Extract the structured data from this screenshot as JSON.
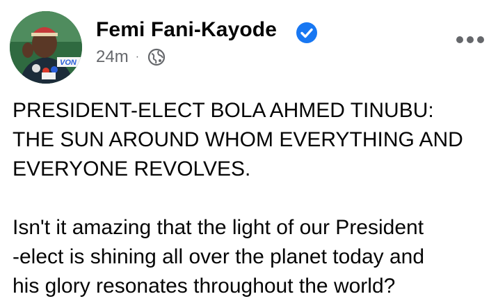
{
  "post": {
    "author": {
      "name": "Femi Fani-Kayode",
      "verified": true,
      "avatar_banner_text": "VON"
    },
    "timestamp": "24m",
    "separator": "·",
    "privacy_icon": "globe-icon",
    "more_icon": "more-horizontal-icon",
    "paragraphs": [
      "PRESIDENT-ELECT BOLA AHMED TINUBU:\nTHE SUN AROUND WHOM EVERYTHING AND\nEVERYONE REVOLVES.",
      "Isn't it amazing that the light of our President\n-elect is shining all over the planet today and\nhis glory resonates throughout the world?"
    ]
  },
  "colors": {
    "text_primary": "#050505",
    "text_secondary": "#65676b",
    "verified_blue": "#1877f2",
    "avatar_bg": "#3c7a4c"
  }
}
